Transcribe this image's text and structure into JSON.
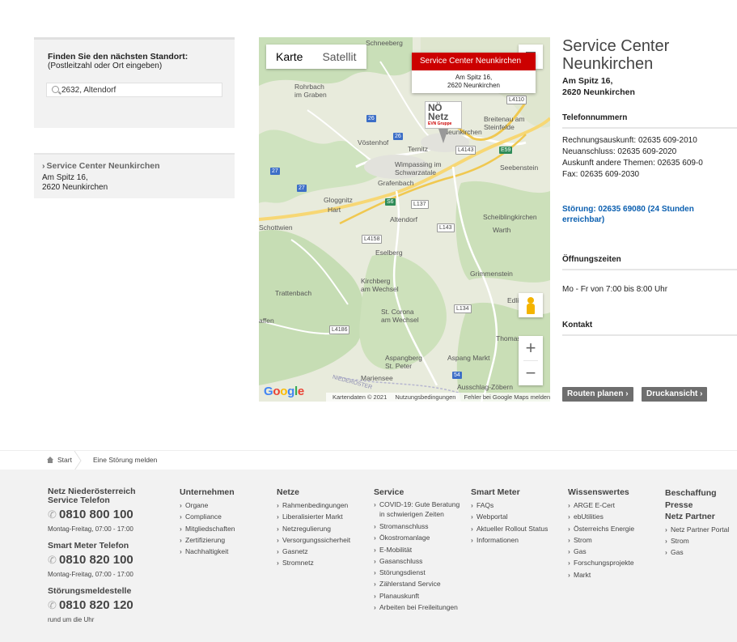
{
  "finder": {
    "title": "Finden Sie den nächsten Standort:",
    "hint": "(Postleitzahl oder Ort eingeben)",
    "search_value": "2632, Altendorf"
  },
  "result": {
    "name": "Service Center Neunkirchen",
    "addr1": "Am Spitz 16,",
    "addr2": "2620 Neunkirchen"
  },
  "map": {
    "tab_map": "Karte",
    "tab_satellite": "Satellit",
    "info_title": "Service Center Neunkirchen",
    "info_line1": "Am Spitz 16,",
    "info_line2": "2620 Neunkirchen",
    "marker_l1": "NÖ",
    "marker_l2": "Netz",
    "marker_l3": "EVN Gruppe",
    "zoom_in": "+",
    "zoom_out": "−",
    "google_logo": [
      "G",
      "o",
      "o",
      "g",
      "l",
      "e"
    ],
    "footer_data": "Kartendaten © 2021",
    "footer_terms": "Nutzungsbedingungen",
    "footer_report": "Fehler bei Google Maps melden",
    "labels": {
      "schneeberg": "Schneeberg",
      "rohrbach": "Rohrbach\nim Graben",
      "voestenhof": "Vöstenhof",
      "ternitz": "Ternitz",
      "neunkirchen": "Neunkirchen",
      "breitenau": "Breitenau am\nSteinfelde",
      "wimpassing": "Wimpassing im\nSchwarzatale",
      "seebenstein": "Seebenstein",
      "grafenbach": "Grafenbach",
      "gloggnitz": "Gloggnitz",
      "hart": "Hart",
      "altendorf": "Altendorf",
      "scheiblingkirchen": "Scheiblingkirchen",
      "warth": "Warth",
      "schottwien": "Schottwien",
      "eselberg": "Eselberg",
      "grimmenstein": "Grimmenstein",
      "kirchberg": "Kirchberg\nam Wechsel",
      "trattenbach": "Trattenbach",
      "edlitz": "Edlitz",
      "stcorona": "St. Corona\nam Wechsel",
      "affen": "affen",
      "thomasberg": "Thomas",
      "aspangberg": "Aspangberg\nSt. Peter",
      "aspangmarkt": "Aspang Markt",
      "mariensee": "Mariensee",
      "ausschlag": "Ausschlag-Zöbern",
      "niederoest": "NIEDERÖSTER"
    },
    "shields": {
      "s26a": "26",
      "s26b": "26",
      "s27a": "27",
      "s27b": "27",
      "l4110": "L4110",
      "l4143": "L4143",
      "e59": "E59",
      "s6": "S6",
      "l137": "L137",
      "l143": "L143",
      "l4158": "L4158",
      "l134": "L134",
      "l4186": "L4186",
      "s54": "54"
    }
  },
  "details": {
    "title": "Service Center Neunkirchen",
    "addr1": "Am Spitz 16,",
    "addr2": "2620 Neunkirchen",
    "phones_heading": "Telefonnummern",
    "phone_lines": [
      "Rechnungsauskunft: 02635 609-2010",
      "Neuanschluss: 02635 609-2020",
      "Auskunft andere Themen: 02635 609-0",
      "Fax: 02635 609-2030"
    ],
    "stoerung": "Störung: 02635 69080 (24 Stunden erreichbar)",
    "hours_heading": "Öffnungszeiten",
    "hours": "Mo - Fr von 7:00 bis 8:00 Uhr",
    "contact_heading": "Kontakt",
    "route_button": "Routen planen",
    "print_button": "Druckansicht"
  },
  "breadcrumb": {
    "start": "Start",
    "current": "Eine Störung melden"
  },
  "footer": {
    "contacts": [
      {
        "title": "Netz Niederösterreich Service Telefon",
        "number": "0810 800 100",
        "note": "Montag-Freitag, 07:00 - 17:00"
      },
      {
        "title": "Smart Meter Telefon",
        "number": "0810 820 100",
        "note": "Montag-Freitag, 07:00 - 17:00"
      },
      {
        "title": "Störungsmeldestelle",
        "number": "0810 820 120",
        "note": "rund um die Uhr"
      }
    ],
    "columns": [
      {
        "heading": "Unternehmen",
        "links": [
          "Organe",
          "Compliance",
          "Mitgliedschaften",
          "Zertifizierung",
          "Nachhaltigkeit"
        ]
      },
      {
        "heading": "Netze",
        "links": [
          "Rahmenbedingungen",
          "Liberalisierter Markt",
          "Netzregulierung",
          "Versorgungssicherheit",
          "Gasnetz",
          "Stromnetz"
        ]
      },
      {
        "heading": "Service",
        "links": [
          "COVID-19: Gute Beratung\nin schwierigen Zeiten",
          "Stromanschluss",
          "Ökostromanlage",
          "E-Mobilität",
          "Gasanschluss",
          "Störungsdienst",
          "Zählerstand Service",
          "Planauskunft",
          "Arbeiten bei Freileitungen"
        ]
      },
      {
        "heading": "Smart Meter",
        "links": [
          "FAQs",
          "Webportal",
          "Aktueller Rollout Status",
          "Informationen"
        ]
      },
      {
        "heading": "Wissenswertes",
        "links": [
          "ARGE E-Cert",
          "ebUtilities",
          "Österreichs Energie",
          "Strom",
          "Gas",
          "Forschungsprojekte",
          "Markt"
        ]
      },
      {
        "heading": "Beschaffung\nPresse\nNetz Partner",
        "links": [
          "Netz Partner Portal",
          "Strom",
          "Gas"
        ]
      }
    ]
  }
}
